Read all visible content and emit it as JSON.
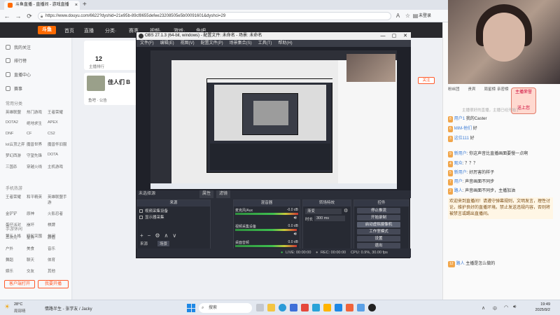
{
  "browser": {
    "tab_title": "斗鱼直播 - 直播间 - 游戏直播",
    "tab_close": "×",
    "new_tab": "+",
    "window_controls": [
      "—",
      "▢",
      "✕"
    ],
    "url": "https://www.douyu.com/6622?dyshid=21e95b-89cf8655defee23208505e5b00091601&dyshci=29",
    "sign_in": "未登录"
  },
  "site": {
    "logo": "斗鱼",
    "nav": [
      "首页",
      "直播",
      "分类·",
      "赛事",
      "视频·",
      "游戏·",
      "鱼吧"
    ],
    "sidebar": {
      "items": [
        "我的关注",
        "排行榜",
        "直播中心",
        "赛事"
      ],
      "section_common": "常用分类",
      "common_grid": [
        "英雄联盟",
        "热门游戏",
        "王者荣耀",
        "DOTA2",
        "绝地求生",
        "APEX",
        "DNF",
        "CF",
        "CS2",
        "lol云顶之弈",
        "魔兽世界",
        "魔兽怀旧服",
        "梦幻西游",
        "守望先锋",
        "DOTA",
        "三国杀",
        "穿越火线",
        "主机游戏"
      ],
      "section_mobile": "手机热游",
      "mobile_grid": [
        "王者荣耀",
        "和平精英",
        "英雄联盟手游",
        "金铲铲",
        "原神",
        "火影忍者",
        "蛋仔派对",
        "崩坏",
        "棋牌",
        "第五人格",
        "暗区突围",
        "休闲"
      ],
      "section_hand": "手游休闲",
      "hand_grid": [
        "二次元",
        "星秀",
        "颜值",
        "户外",
        "美食",
        "音乐",
        "舞蹈",
        "聊天",
        "体育",
        "娱乐",
        "交友",
        "其他"
      ],
      "btn_open": "客户端打开",
      "btn_live": "我要开播"
    },
    "room": {
      "count": "12",
      "count_label": "主播排行",
      "card_title": "佳人们 B",
      "card_sub": "鱼吧 · 公告",
      "follow": "关注"
    }
  },
  "obs": {
    "title": "OBS 27.1.3 (64-bit, windows) - 配置文件: 未命名 - 场景: 未命名",
    "menu": [
      "文件(F)",
      "编辑(E)",
      "视图(V)",
      "配置文件(P)",
      "场景集合(S)",
      "工具(T)",
      "帮助(H)"
    ],
    "scene_bar": "未选择源",
    "scene_tabs": [
      "属性",
      "滤镜"
    ],
    "sources_header": "来源",
    "sources": [
      "视频采集设备",
      "显示器采集"
    ],
    "mixer_header": "混音器",
    "mixer": [
      {
        "name": "麦克风/Aux",
        "db": "-0.0 dB"
      },
      {
        "name": "视频采集设备",
        "db": "0.0 dB"
      },
      {
        "name": "桌面音频",
        "db": "0.0 dB"
      }
    ],
    "transitions_header": "转场特效",
    "transition_type": "渐变",
    "duration_label": "时长",
    "duration_value": "300 ms",
    "controls_header": "控件",
    "controls": [
      "停止推流",
      "开始录制",
      "启动虚拟摄像机",
      "工作室模式",
      "设置",
      "退出"
    ],
    "scenes_footer": [
      "来源",
      "场景"
    ],
    "status": {
      "live": "LIVE: 00:00:00",
      "rec": "REC: 00:00:00",
      "cpu": "CPU: 0.9%, 30.00 fps"
    }
  },
  "chat": {
    "tabs": [
      "粉丝团",
      "贵宾",
      "周星榜",
      "亲密榜"
    ],
    "notice": "主播很好的直播，主播已经开始了",
    "gift_label": "主播荣誉",
    "gift_badge": "送上您",
    "messages": [
      {
        "user": "用户1",
        "text": "我的Caster"
      },
      {
        "user": "MiM-他们",
        "text": "好"
      },
      {
        "user": "这位111",
        "text": "好"
      },
      {
        "user": "新用户",
        "text": "你这声音比直播画面要慢一点啊"
      },
      {
        "user": "观众",
        "text": "？？？"
      },
      {
        "user": "新用户",
        "text": "好厉害的样子"
      },
      {
        "user": "用户",
        "text": "声音画面不同步"
      },
      {
        "user": "路人",
        "text": "声音画面不同步，主播加油"
      },
      {
        "user": "路人",
        "text": "主播是怎么做的"
      }
    ],
    "big_message": "欢迎来到直播间！请遵守弹幕规则，文明发言，理性讨论，维护良好的直播环境。禁止发送违规内容，否则将被禁言或踢出直播间。"
  },
  "taskbar": {
    "weather_temp": "28°C",
    "weather_text": "局部晴",
    "media": "情路半生 - 张学友 / Jacky",
    "search": "搜索",
    "time": "19:49",
    "date": "2025/9/2"
  }
}
